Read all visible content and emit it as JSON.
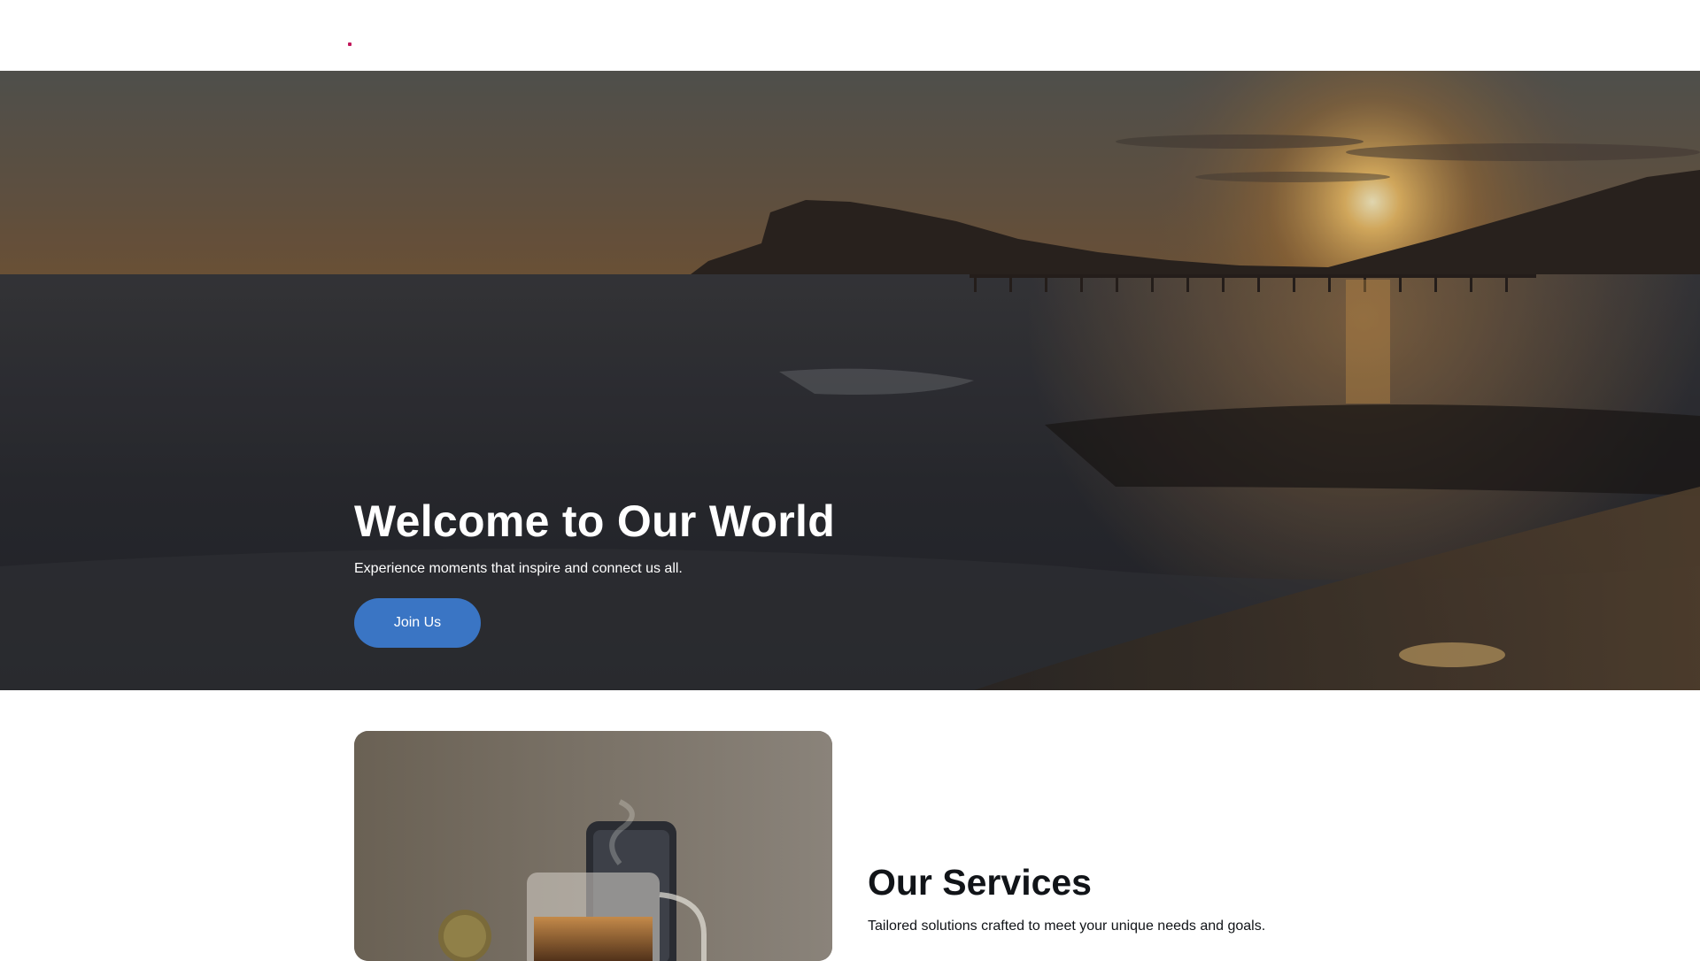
{
  "hero": {
    "title": "Welcome to Our World",
    "subtitle": "Experience moments that inspire and connect us all.",
    "button_label": "Join Us"
  },
  "services": {
    "title": "Our Services",
    "description": "Tailored solutions crafted to meet your unique needs and goals."
  },
  "colors": {
    "accent": "#3a75c4",
    "logo_accent": "#c2185b",
    "heading_text": "#111418"
  }
}
